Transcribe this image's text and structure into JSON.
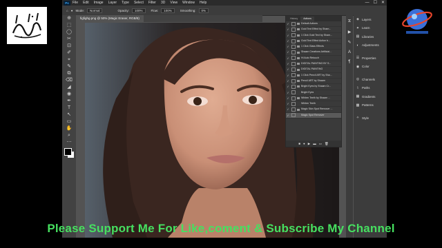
{
  "channel_logo_text": "سبحان الله",
  "banner": "Please Support Me For Like,coment & Subscribe My Channel",
  "menu": {
    "app_icon": "Ps",
    "items": [
      "File",
      "Edit",
      "Image",
      "Layer",
      "Type",
      "Select",
      "Filter",
      "3D",
      "View",
      "Window",
      "Help"
    ],
    "min": "—",
    "max": "☐",
    "close": "✕"
  },
  "options": {
    "mode_label": "Mode:",
    "mode_value": "Normal",
    "opacity_label": "Opacity:",
    "opacity_value": "100%",
    "flow_label": "Flow:",
    "flow_value": "100%",
    "smoothing_label": "Smoothing:",
    "smoothing_value": "0%"
  },
  "document_tab": "figfighg.png @ 50% (Magic Eraser, RGB/8)",
  "actions_panel": {
    "tabs": [
      "History",
      "Actions"
    ],
    "items": [
      {
        "label": "Default Actions",
        "type": "folder"
      },
      {
        "label": "Gold Text Effect by Sham...",
        "type": "folder"
      },
      {
        "label": "1 Click Gold Text by Sham...",
        "type": "folder"
      },
      {
        "label": "Gold Text Effect Action b...",
        "type": "folder"
      },
      {
        "label": "1 Click Glass Effects",
        "type": "folder"
      },
      {
        "label": "Shaam Creations Artificial...",
        "type": "folder"
      },
      {
        "label": "Hi Auto Retouch",
        "type": "folder"
      },
      {
        "label": "DIGITAL PAINTING BY S...",
        "type": "folder"
      },
      {
        "label": "DIGITAL PAINTING",
        "type": "folder"
      },
      {
        "label": "1 Click Pencil ART by Sha...",
        "type": "folder"
      },
      {
        "label": "Pencil ART by Shaam",
        "type": "folder"
      },
      {
        "label": "Bright Eyes by Shaam Cr...",
        "type": "folder"
      },
      {
        "label": "Bright Eyes",
        "type": "action"
      },
      {
        "label": "Whiten Teeth by Shaam ...",
        "type": "folder"
      },
      {
        "label": "Whiten Teeth",
        "type": "action"
      },
      {
        "label": "Magic Skin Spot Remover ...",
        "type": "folder"
      },
      {
        "label": "Magic Spot Remover",
        "type": "action",
        "selected": true
      }
    ],
    "footer": [
      "■",
      "●",
      "▶",
      "▬",
      "▭",
      "🗑"
    ]
  },
  "right_panels": [
    {
      "label": "Layers",
      "icon": "layers-icon",
      "glyph": "◈"
    },
    {
      "label": "Learn",
      "icon": "learn-icon",
      "glyph": "✦"
    },
    {
      "label": "Libraries",
      "icon": "libraries-icon",
      "glyph": "▤"
    },
    {
      "label": "Adjustments",
      "icon": "adjustments-icon",
      "glyph": "◐"
    },
    {
      "label": "Properties",
      "icon": "properties-icon",
      "glyph": "☰",
      "gap": true
    },
    {
      "label": "Color",
      "icon": "color-icon",
      "glyph": "◉"
    },
    {
      "label": "Channels",
      "icon": "channels-icon",
      "glyph": "◎",
      "gap": true
    },
    {
      "label": "Paths",
      "icon": "paths-icon",
      "glyph": "⌇"
    },
    {
      "label": "Gradients",
      "icon": "gradients-icon",
      "glyph": "▦"
    },
    {
      "label": "Patterns",
      "icon": "patterns-icon",
      "glyph": "▩"
    },
    {
      "label": "Style",
      "icon": "style-icon",
      "glyph": "✧",
      "gap": true
    }
  ],
  "tools": [
    "⊕",
    "⬚",
    "◯",
    "✂",
    "⊡",
    "✐",
    "⌖",
    "✎",
    "⧉",
    "⌫",
    "◢",
    "◉",
    "✒",
    "T",
    "↖",
    "▭",
    "✋",
    "⌕",
    "⋯"
  ]
}
